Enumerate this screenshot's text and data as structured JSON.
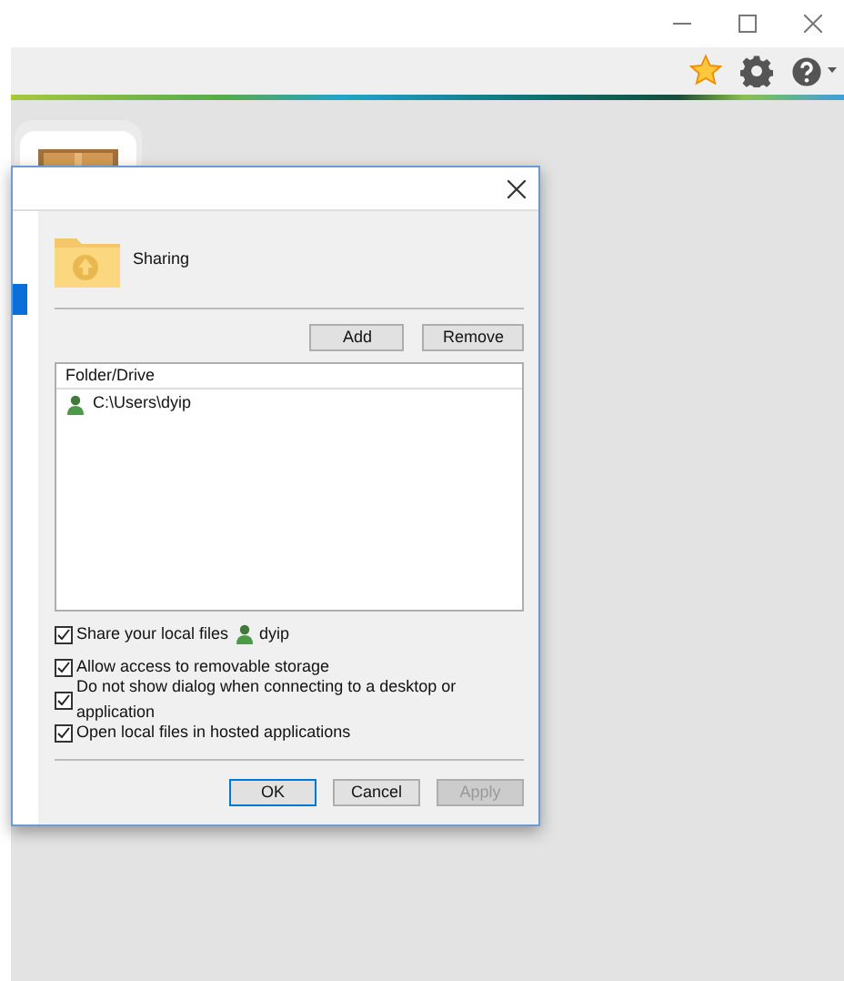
{
  "dialog": {
    "heading": "Sharing",
    "actions": [
      {
        "label": "Add",
        "disabled": false
      },
      {
        "label": "Remove",
        "disabled": false
      }
    ],
    "list": {
      "column": "Folder/Drive",
      "rows": [
        {
          "path": "C:\\Users\\dyip"
        }
      ]
    },
    "options": [
      {
        "label": "Share your local files",
        "user": "dyip",
        "checked": true
      },
      {
        "label": "Allow access to removable storage",
        "checked": true
      },
      {
        "label": "Do not show dialog when connecting to a desktop or application",
        "checked": true
      },
      {
        "label": "Open local files in hosted applications",
        "checked": true
      }
    ],
    "buttons": [
      {
        "label": "OK",
        "default": true,
        "disabled": false
      },
      {
        "label": "Cancel",
        "default": false,
        "disabled": false
      },
      {
        "label": "Apply",
        "default": false,
        "disabled": true
      }
    ]
  }
}
